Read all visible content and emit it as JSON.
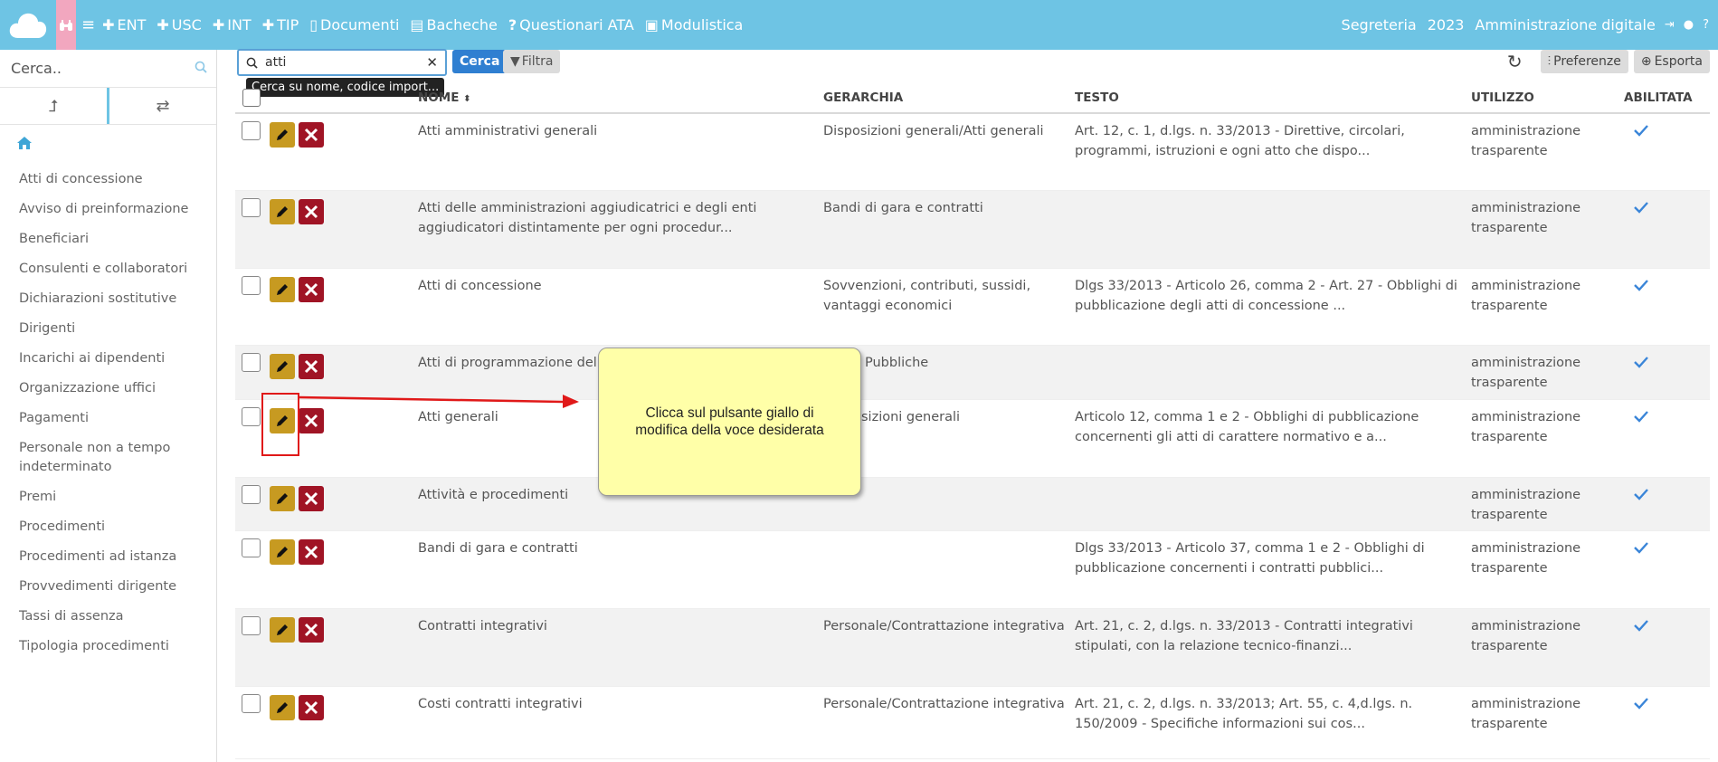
{
  "topbar": {
    "nav": [
      {
        "icon": "plus",
        "label": "ENT"
      },
      {
        "icon": "plus",
        "label": "USC"
      },
      {
        "icon": "plus",
        "label": "INT"
      },
      {
        "icon": "plus",
        "label": "TIP"
      },
      {
        "icon": "document",
        "label": "Documenti"
      },
      {
        "icon": "board",
        "label": "Bacheche"
      },
      {
        "icon": "question",
        "label": "Questionari ATA"
      },
      {
        "icon": "briefcase",
        "label": "Modulistica"
      }
    ],
    "office": "Segreteria",
    "year": "2023",
    "module": "Amministrazione digitale"
  },
  "sidebar": {
    "search_placeholder": "Cerca..",
    "items": [
      "Atti di concessione",
      "Avviso di preinformazione",
      "Beneficiari",
      "Consulenti e collaboratori",
      "Dichiarazioni sostitutive",
      "Dirigenti",
      "Incarichi ai dipendenti",
      "Organizzazione uffici",
      "Pagamenti",
      "Personale non a tempo indeterminato",
      "Premi",
      "Procedimenti",
      "Procedimenti ad istanza",
      "Provvedimenti dirigente",
      "Tassi di assenza",
      "Tipologia procedimenti"
    ]
  },
  "toolbar": {
    "search_value": "atti",
    "search_label": "Cerca",
    "filter_label": "Filtra",
    "preferences_label": "Preferenze",
    "export_label": "Esporta",
    "tooltip": "Cerca su nome, codice import..."
  },
  "table": {
    "headers": {
      "nome": "NOME",
      "gerarchia": "GERARCHIA",
      "testo": "TESTO",
      "utilizzo": "UTILIZZO",
      "abilitata": "ABILITATA"
    },
    "rows": [
      {
        "nome": "Atti amministrativi generali",
        "gerarchia": "Disposizioni generali/Atti generali",
        "testo": "Art. 12, c. 1, d.lgs. n. 33/2013 - Direttive, circolari, programmi, istruzioni e ogni atto che dispo...",
        "utilizzo": "amministrazione trasparente"
      },
      {
        "nome": "Atti delle amministrazioni aggiudicatrici e degli enti aggiudicatori distintamente per ogni procedur...",
        "gerarchia": "Bandi di gara e contratti",
        "testo": "",
        "utilizzo": "amministrazione trasparente"
      },
      {
        "nome": "Atti di concessione",
        "gerarchia": "Sovvenzioni, contributi, sussidi, vantaggi economici",
        "testo": "Dlgs 33/2013 - Articolo 26, comma 2 - Art. 27 - Obblighi di pubblicazione degli atti di concessione ...",
        "utilizzo": "amministrazione trasparente"
      },
      {
        "nome": "Atti di programmazione delle",
        "gerarchia": "Pubbliche",
        "testo": "",
        "utilizzo": "amministrazione trasparente"
      },
      {
        "nome": "Atti generali",
        "gerarchia": "sizioni generali",
        "testo": "Articolo 12, comma 1 e 2 - Obblighi di pubblicazione concernenti gli atti di carattere normativo e a...",
        "utilizzo": "amministrazione trasparente"
      },
      {
        "nome": "Attività e procedimenti",
        "gerarchia": "",
        "testo": "",
        "utilizzo": "amministrazione trasparente"
      },
      {
        "nome": "Bandi di gara e contratti",
        "gerarchia": "",
        "testo": "Dlgs 33/2013 - Articolo 37, comma 1 e 2 - Obblighi di pubblicazione concernenti i contratti pubblici...",
        "utilizzo": "amministrazione trasparente"
      },
      {
        "nome": "Contratti integrativi",
        "gerarchia": "Personale/Contrattazione integrativa",
        "testo": "Art. 21, c. 2, d.lgs. n. 33/2013 - Contratti integrativi stipulati, con la relazione tecnico-finanzi...",
        "utilizzo": "amministrazione trasparente"
      },
      {
        "nome": "Costi contratti integrativi",
        "gerarchia": "Personale/Contrattazione integrativa",
        "testo": "Art. 21, c. 2, d.lgs. n. 33/2013; Art. 55, c. 4,d.lgs. n. 150/2009 - Specifiche informazioni sui cos...",
        "utilizzo": "amministrazione trasparente"
      }
    ]
  },
  "annotation": {
    "callout_text": "Clicca sul pulsante giallo di modifica della voce desiderata",
    "color": "#e01919"
  }
}
